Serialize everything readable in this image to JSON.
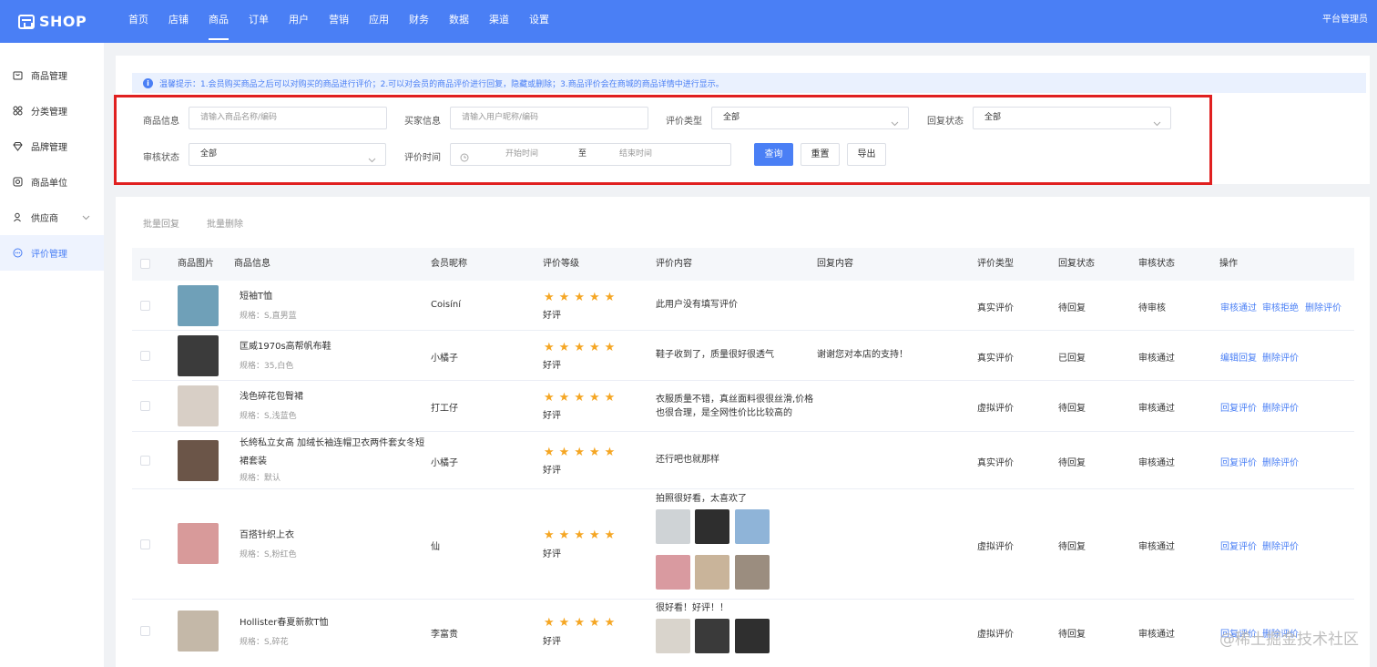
{
  "app": {
    "logo_text": "SHOP",
    "admin_label": "平台管理员"
  },
  "nav": [
    {
      "label": "首页"
    },
    {
      "label": "店铺"
    },
    {
      "label": "商品",
      "active": true
    },
    {
      "label": "订单"
    },
    {
      "label": "用户"
    },
    {
      "label": "营销"
    },
    {
      "label": "应用"
    },
    {
      "label": "财务"
    },
    {
      "label": "数据"
    },
    {
      "label": "渠道"
    },
    {
      "label": "设置"
    }
  ],
  "sidebar": {
    "items": [
      {
        "label": "商品管理",
        "icon": "bag-icon"
      },
      {
        "label": "分类管理",
        "icon": "grid-icon"
      },
      {
        "label": "品牌管理",
        "icon": "diamond-icon"
      },
      {
        "label": "商品单位",
        "icon": "target-icon"
      },
      {
        "label": "供应商",
        "icon": "user-icon",
        "has_arrow": true
      },
      {
        "label": "评价管理",
        "icon": "chat-icon",
        "active": true
      }
    ]
  },
  "tip": {
    "text": "温馨提示：1.会员购买商品之后可以对购买的商品进行评价；2.可以对会员的商品评价进行回复，隐藏或删除；3.商品评价会在商城的商品详情中进行显示。"
  },
  "filters": {
    "product_info": {
      "label": "商品信息",
      "placeholder": "请输入商品名称/编码"
    },
    "buyer_info": {
      "label": "买家信息",
      "placeholder": "请输入用户昵称/编码"
    },
    "review_type": {
      "label": "评价类型",
      "value": "全部"
    },
    "reply_status": {
      "label": "回复状态",
      "value": "全部"
    },
    "audit_status": {
      "label": "审核状态",
      "value": "全部"
    },
    "review_time": {
      "label": "评价时间",
      "start_placeholder": "开始时间",
      "separator": "至",
      "end_placeholder": "结束时间"
    },
    "search_button": "查询",
    "reset_button": "重置",
    "export_button": "导出"
  },
  "bulk": {
    "reply": "批量回复",
    "delete": "批量删除"
  },
  "table": {
    "headers": {
      "image": "商品图片",
      "info": "商品信息",
      "nickname": "会员昵称",
      "grade": "评价等级",
      "content": "评价内容",
      "reply": "回复内容",
      "type": "评价类型",
      "reply_status": "回复状态",
      "audit_status": "审核状态",
      "actions": "操作"
    },
    "rows": [
      {
        "name": "短袖T恤",
        "spec": "规格：S,直男蓝",
        "nickname": "Coisíní",
        "stars": 5,
        "grade": "好评",
        "content": "此用户没有填写评价",
        "reply": "",
        "type": "真实评价",
        "reply_status": "待回复",
        "audit_status": "待审核",
        "actions": [
          "审核通过",
          "审核拒绝",
          "删除评价"
        ],
        "thumb_color": "#6fa0b8"
      },
      {
        "name": "匡威1970s高帮帆布鞋",
        "spec": "规格：35,白色",
        "nickname": "小橘子",
        "stars": 5,
        "grade": "好评",
        "content": "鞋子收到了，质量很好很透气",
        "reply": "谢谢您对本店的支持！",
        "type": "真实评价",
        "reply_status": "已回复",
        "audit_status": "审核通过",
        "actions": [
          "编辑回复",
          "删除评价"
        ],
        "thumb_color": "#3b3b3b"
      },
      {
        "name": "浅色碎花包臀裙",
        "spec": "规格：S,浅蓝色",
        "nickname": "打工仔",
        "stars": 5,
        "grade": "好评",
        "content_lines": [
          "衣服质量不错，真丝面料很很丝滑,价格",
          "也很合理，是全网性价比比较高的"
        ],
        "reply": "",
        "type": "虚拟评价",
        "reply_status": "待回复",
        "audit_status": "审核通过",
        "actions": [
          "回复评价",
          "删除评价"
        ],
        "thumb_color": "#d8cfc6"
      },
      {
        "name_lines": [
          "长絝私立女高 加绒长袖连帽卫衣两件套女冬短",
          "裙套装"
        ],
        "spec": "规格：默认",
        "nickname": "小橘子",
        "stars": 5,
        "grade": "好评",
        "content": "还行吧也就那样",
        "reply": "",
        "type": "真实评价",
        "reply_status": "待回复",
        "audit_status": "审核通过",
        "actions": [
          "回复评价",
          "删除评价"
        ],
        "thumb_color": "#6b5548"
      },
      {
        "name": "百搭针织上衣",
        "spec": "规格：S,粉红色",
        "nickname": "仙",
        "stars": 5,
        "grade": "好评",
        "content": "拍照很好看，太喜欢了",
        "reply": "",
        "type": "虚拟评价",
        "reply_status": "待回复",
        "audit_status": "审核通过",
        "actions": [
          "回复评价",
          "删除评价"
        ],
        "thumb_color": "#d89a9a",
        "images": [
          "#cfd3d6",
          "#2e2e2e",
          "#8fb4d8",
          "#d99aa0",
          "#c9b49a",
          "#9b8d7f"
        ]
      },
      {
        "name": "Hollister春夏新款T恤",
        "spec": "规格：S,碎花",
        "nickname": "李富贵",
        "stars": 5,
        "grade": "好评",
        "content": "很好看！好评！！",
        "reply": "",
        "type": "虚拟评价",
        "reply_status": "待回复",
        "audit_status": "审核通过",
        "actions": [
          "回复评价",
          "删除评价"
        ],
        "thumb_color": "#c4b8a8",
        "images": [
          "#d9d4cc",
          "#3a3a3a",
          "#2f2f2f"
        ]
      }
    ]
  },
  "watermark": "@稀土掘金技术社区"
}
